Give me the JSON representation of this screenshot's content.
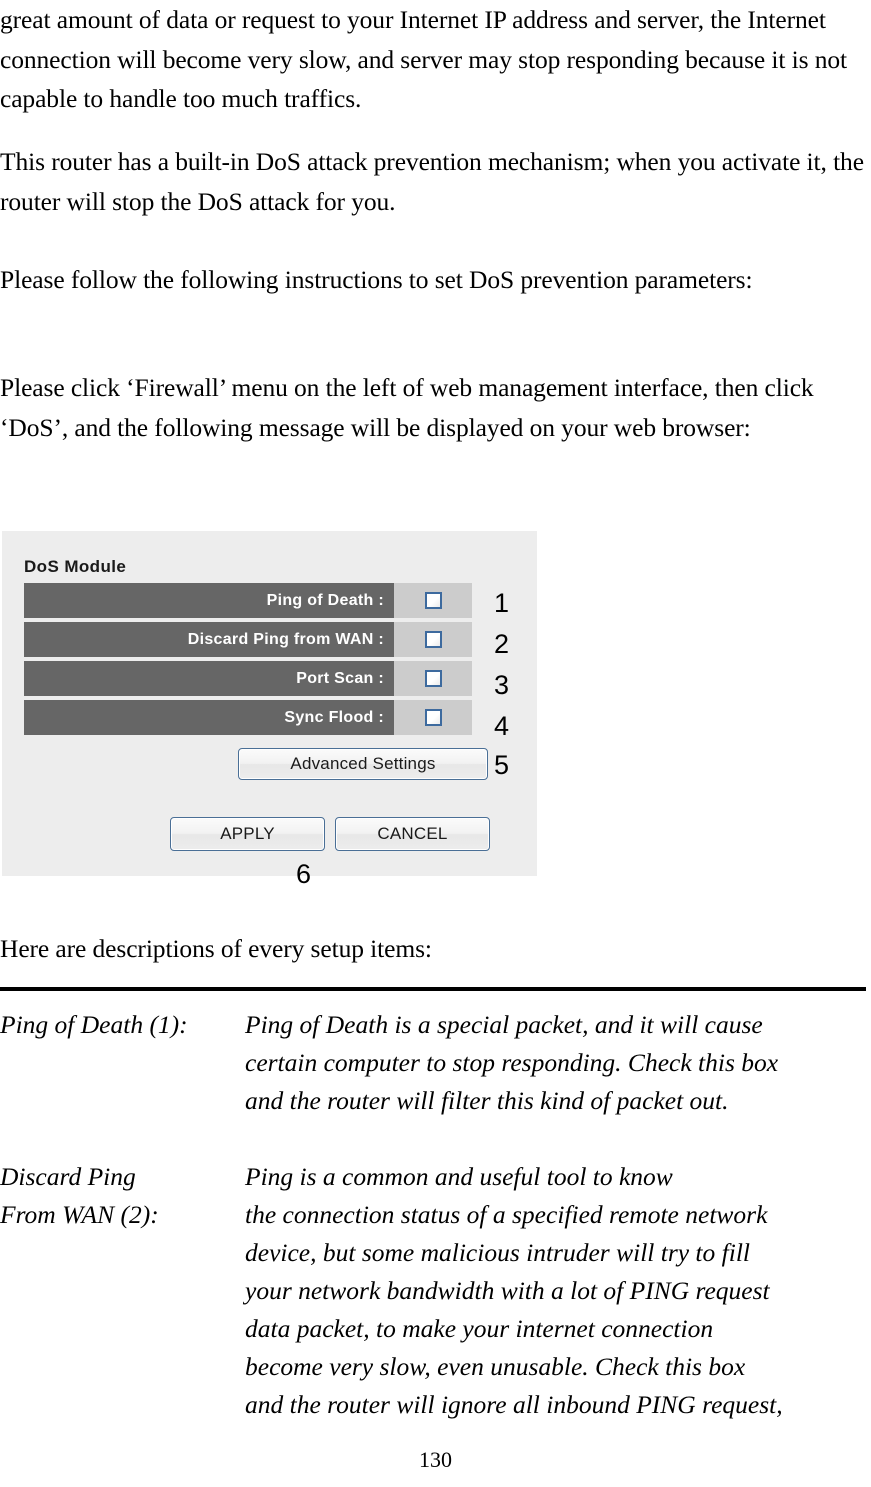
{
  "document": {
    "page_number": "130",
    "paragraphs": {
      "intro": "great amount of data or request to your Internet IP address and server, the Internet connection will become very slow, and server may stop responding because it is not capable to handle too much traffics.",
      "builtin": "This router has a built-in DoS attack prevention mechanism; when you activate it, the router will stop the DoS attack for you.",
      "follow": "Please follow the following instructions to set DoS prevention parameters:",
      "click": "Please click ‘Firewall’ menu on the left of web management interface, then click ‘DoS’, and the following message will be displayed on your web browser:",
      "here": "Here are descriptions of every setup items:"
    }
  },
  "screenshot": {
    "title": "DoS Module",
    "colors": {
      "panel_bg": "#ededed",
      "row_label_bg": "#666666",
      "row_value_bg": "#cccccc",
      "checkbox_border": "#3d6a9e",
      "button_border": "#4a6f96"
    },
    "rows": [
      {
        "label": "Ping of Death :",
        "checked": false,
        "callout": "1"
      },
      {
        "label": "Discard Ping from WAN :",
        "checked": false,
        "callout": "2"
      },
      {
        "label": "Port Scan :",
        "checked": false,
        "callout": "3"
      },
      {
        "label": "Sync Flood :",
        "checked": false,
        "callout": "4"
      }
    ],
    "buttons": {
      "advanced": "Advanced Settings",
      "apply": "APPLY",
      "cancel": "CANCEL"
    },
    "callouts": {
      "advanced": "5",
      "apply_cancel": "6"
    }
  },
  "definitions": [
    {
      "term_lines": [
        "Ping of Death (1):"
      ],
      "body_lines": [
        "Ping of Death is a special packet, and it will cause",
        "certain computer to stop responding. Check this box",
        "and the router will filter this kind of packet out."
      ]
    },
    {
      "term_lines": [
        "Discard Ping",
        "From WAN (2):"
      ],
      "body_lines": [
        "Ping is a common and useful tool to know",
        "the connection status of a specified remote network",
        "device, but some malicious intruder will try to fill",
        "your network bandwidth with a lot of PING request",
        "data packet, to make your internet connection",
        "become very slow, even unusable. Check this box",
        "and the router will ignore all inbound PING request,"
      ]
    }
  ]
}
